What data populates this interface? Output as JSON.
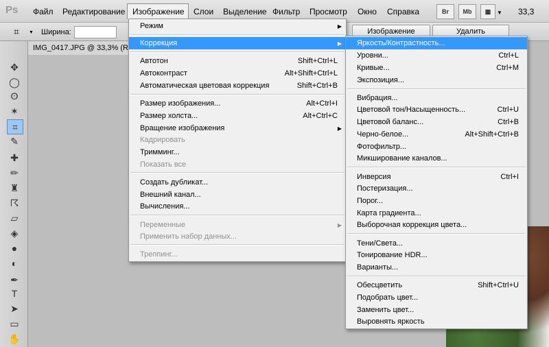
{
  "app_logo": "Ps",
  "menubar": {
    "items": [
      "Файл",
      "Редактирование",
      "Изображение",
      "Слои",
      "Выделение",
      "Фильтр",
      "Просмотр",
      "Окно",
      "Справка"
    ],
    "bridge_label": "Br",
    "minibridge_label": "Mb",
    "zoom": "33,3"
  },
  "options_bar": {
    "width_label": "Ширина:",
    "image_button": "Изображение",
    "delete_button": "Удалить"
  },
  "document": {
    "tab_label": "IMG_0417.JPG @ 33,3% (RGB"
  },
  "image_menu": {
    "items": [
      {
        "label": "Режим",
        "submenu": true
      },
      {
        "label": "Коррекция",
        "submenu": true,
        "highlighted": true
      },
      {
        "label": "Автотон",
        "shortcut": "Shift+Ctrl+L"
      },
      {
        "label": "Автоконтраст",
        "shortcut": "Alt+Shift+Ctrl+L"
      },
      {
        "label": "Автоматическая цветовая коррекция",
        "shortcut": "Shift+Ctrl+B"
      },
      {
        "label": "Размер изображения...",
        "shortcut": "Alt+Ctrl+I"
      },
      {
        "label": "Размер холста...",
        "shortcut": "Alt+Ctrl+C"
      },
      {
        "label": "Вращение изображения",
        "submenu": true
      },
      {
        "label": "Кадрировать",
        "disabled": true
      },
      {
        "label": "Тримминг..."
      },
      {
        "label": "Показать все",
        "disabled": true
      },
      {
        "label": "Создать дубликат..."
      },
      {
        "label": "Внешний канал..."
      },
      {
        "label": "Вычисления..."
      },
      {
        "label": "Переменные",
        "submenu": true,
        "disabled": true
      },
      {
        "label": "Применить набор данных...",
        "disabled": true
      },
      {
        "label": "Треппинг...",
        "disabled": true
      }
    ]
  },
  "correction_menu": {
    "items": [
      {
        "label": "Яркость/Контрастность...",
        "highlighted": true
      },
      {
        "label": "Уровни...",
        "shortcut": "Ctrl+L"
      },
      {
        "label": "Кривые...",
        "shortcut": "Ctrl+M"
      },
      {
        "label": "Экспозиция..."
      },
      {
        "label": "Вибрация..."
      },
      {
        "label": "Цветовой тон/Насыщенность...",
        "shortcut": "Ctrl+U"
      },
      {
        "label": "Цветовой баланс...",
        "shortcut": "Ctrl+B"
      },
      {
        "label": "Черно-белое...",
        "shortcut": "Alt+Shift+Ctrl+B"
      },
      {
        "label": "Фотофильтр..."
      },
      {
        "label": "Микширование каналов..."
      },
      {
        "label": "Инверсия",
        "shortcut": "Ctrl+I"
      },
      {
        "label": "Постеризация..."
      },
      {
        "label": "Порог..."
      },
      {
        "label": "Карта градиента..."
      },
      {
        "label": "Выборочная коррекция цвета..."
      },
      {
        "label": "Тени/Света..."
      },
      {
        "label": "Тонирование HDR..."
      },
      {
        "label": "Варианты..."
      },
      {
        "label": "Обесцветить",
        "shortcut": "Shift+Ctrl+U"
      },
      {
        "label": "Подобрать цвет..."
      },
      {
        "label": "Заменить цвет..."
      },
      {
        "label": "Выровнять яркость"
      }
    ]
  },
  "colors": {
    "highlight": "#3399ff",
    "menu_bg": "#f0f0f0",
    "disabled_text": "#8f8f8f"
  }
}
